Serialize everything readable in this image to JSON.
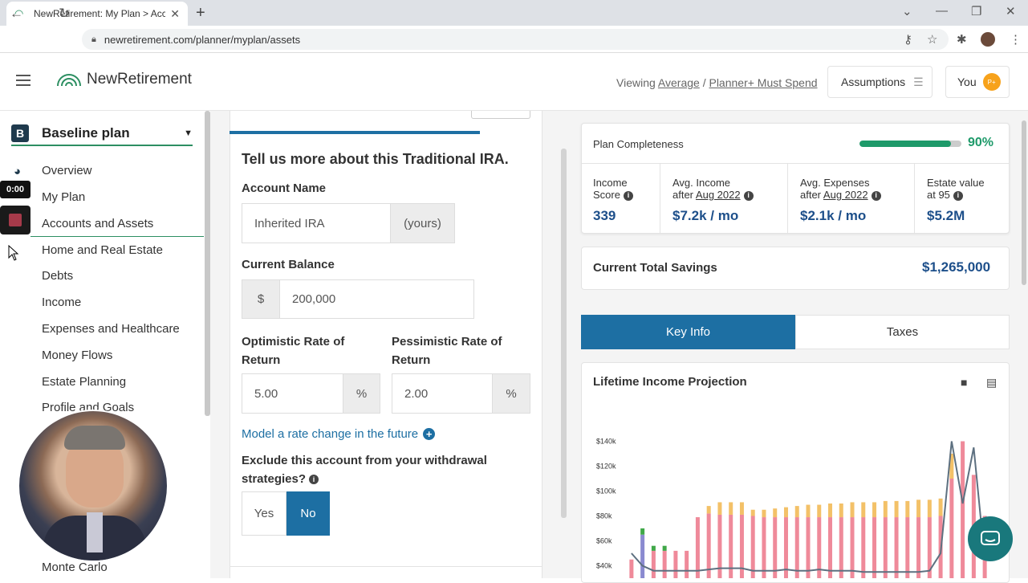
{
  "browser": {
    "tab_title": "NewRetirement: My Plan > Accou",
    "url": "newretirement.com/planner/myplan/assets"
  },
  "header": {
    "logo_text": "NewRetirement",
    "viewing_label": "Viewing",
    "viewing_scenario": "Average",
    "viewing_separator": "/",
    "viewing_plan": "Planner+ Must Spend",
    "assumptions_label": "Assumptions",
    "you_label": "You",
    "you_badge": "P+"
  },
  "sidebar": {
    "plan_letter": "B",
    "plan_name": "Baseline plan",
    "items": [
      {
        "label": "Overview"
      },
      {
        "label": "My Plan"
      },
      {
        "label": "Accounts and Assets"
      },
      {
        "label": "Home and Real Estate"
      },
      {
        "label": "Debts"
      },
      {
        "label": "Income"
      },
      {
        "label": "Expenses and Healthcare"
      },
      {
        "label": "Money Flows"
      },
      {
        "label": "Estate Planning"
      },
      {
        "label": "Profile and Goals"
      }
    ],
    "bottom_item": "Monte Carlo",
    "timer": "0:00"
  },
  "form": {
    "heading": "Tell us more about this Traditional IRA.",
    "account_name_label": "Account Name",
    "account_name_value": "Inherited IRA",
    "account_name_suffix": "(yours)",
    "balance_label": "Current Balance",
    "balance_prefix": "$",
    "balance_value": "200,000",
    "optimistic_label": "Optimistic Rate of Return",
    "optimistic_value": "5.00",
    "pessimistic_label": "Pessimistic Rate of Return",
    "pessimistic_value": "2.00",
    "percent_suffix": "%",
    "rate_change_link": "Model a rate change in the future",
    "exclude_label": "Exclude this account from your withdrawal strategies?",
    "yes_label": "Yes",
    "no_label": "No"
  },
  "completeness": {
    "title": "Plan Completeness",
    "percent_text": "90%",
    "fraction": 0.9,
    "stats": [
      {
        "label1": "Income",
        "label2": "Score",
        "date": "",
        "value": "339"
      },
      {
        "label1": "Avg. Income",
        "label2": "after",
        "date": "Aug 2022",
        "value": "$7.2k / mo"
      },
      {
        "label1": "Avg. Expenses",
        "label2": "after",
        "date": "Aug 2022",
        "value": "$2.1k / mo"
      },
      {
        "label1": "Estate value",
        "label2": "at 95",
        "date": "",
        "value": "$5.2M"
      }
    ]
  },
  "savings": {
    "label": "Current Total Savings",
    "value": "$1,265,000"
  },
  "tabs": {
    "key_info": "Key Info",
    "taxes": "Taxes"
  },
  "chart_data": {
    "type": "bar",
    "title": "Lifetime Income Projection",
    "yticks": [
      "$140k",
      "$120k",
      "$100k",
      "$80k",
      "$60k",
      "$40k"
    ],
    "ylim": [
      30,
      150
    ],
    "colors": {
      "income": "#ef8a9a",
      "supplemental": "#f3c168",
      "other": "#40a848",
      "line": "#5d7080",
      "accent": "#8a8ad0"
    },
    "series": [
      {
        "name": "income",
        "values": [
          45,
          65,
          52,
          52,
          52,
          52,
          79,
          82,
          81,
          81,
          81,
          80,
          79,
          79,
          79,
          79,
          79,
          79,
          79,
          79,
          79,
          79,
          79,
          79,
          79,
          79,
          79,
          79,
          80,
          110,
          140,
          113,
          80
        ]
      },
      {
        "name": "supplemental",
        "values": [
          0,
          0,
          0,
          0,
          0,
          0,
          0,
          6,
          10,
          10,
          10,
          5,
          6,
          7,
          8,
          9,
          10,
          10,
          11,
          11,
          12,
          12,
          12,
          13,
          13,
          13,
          14,
          14,
          14,
          20,
          0,
          0,
          0
        ]
      },
      {
        "name": "other",
        "values": [
          0,
          5,
          4,
          4,
          0,
          0,
          0,
          0,
          0,
          0,
          0,
          0,
          0,
          0,
          0,
          0,
          0,
          0,
          0,
          0,
          0,
          0,
          0,
          0,
          0,
          0,
          0,
          0,
          0,
          0,
          0,
          0,
          0
        ]
      },
      {
        "name": "line",
        "values": [
          50,
          40,
          36,
          36,
          36,
          36,
          36,
          37,
          38,
          38,
          38,
          36,
          36,
          36,
          37,
          36,
          36,
          37,
          36,
          36,
          36,
          35,
          35,
          35,
          35,
          35,
          35,
          36,
          50,
          140,
          90,
          135,
          45
        ]
      }
    ]
  }
}
